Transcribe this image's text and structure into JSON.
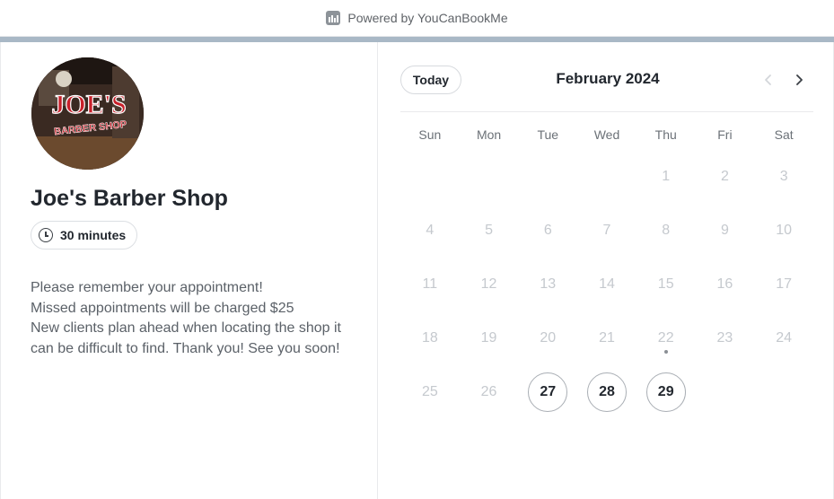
{
  "header": {
    "powered_by": "Powered by YouCanBookMe"
  },
  "profile": {
    "logo_text_1": "JOE'S",
    "logo_text_2": "BARBER SHOP",
    "name": "Joe's Barber Shop",
    "duration": "30 minutes",
    "description": [
      "Please remember your appointment!",
      "Missed appointments will be charged $25",
      "New clients plan ahead when locating the shop it can be difficult to find. Thank you! See you soon!"
    ]
  },
  "calendar": {
    "today_label": "Today",
    "month_label": "February 2024",
    "weekdays": [
      "Sun",
      "Mon",
      "Tue",
      "Wed",
      "Thu",
      "Fri",
      "Sat"
    ],
    "first_weekday_index": 4,
    "days": [
      {
        "n": "1"
      },
      {
        "n": "2"
      },
      {
        "n": "3"
      },
      {
        "n": "4"
      },
      {
        "n": "5"
      },
      {
        "n": "6"
      },
      {
        "n": "7"
      },
      {
        "n": "8"
      },
      {
        "n": "9"
      },
      {
        "n": "10"
      },
      {
        "n": "11"
      },
      {
        "n": "12"
      },
      {
        "n": "13"
      },
      {
        "n": "14"
      },
      {
        "n": "15"
      },
      {
        "n": "16"
      },
      {
        "n": "17"
      },
      {
        "n": "18"
      },
      {
        "n": "19"
      },
      {
        "n": "20"
      },
      {
        "n": "21"
      },
      {
        "n": "22",
        "today": true
      },
      {
        "n": "23"
      },
      {
        "n": "24"
      },
      {
        "n": "25"
      },
      {
        "n": "26"
      },
      {
        "n": "27",
        "available": true
      },
      {
        "n": "28",
        "available": true
      },
      {
        "n": "29",
        "available": true
      }
    ],
    "prev_icon": "chevron-left-icon",
    "next_icon": "chevron-right-icon"
  },
  "colors": {
    "accent_bar": "#a9b8c6",
    "available_border": "#a9aeb4",
    "disabled_day": "#c5c9ce"
  }
}
